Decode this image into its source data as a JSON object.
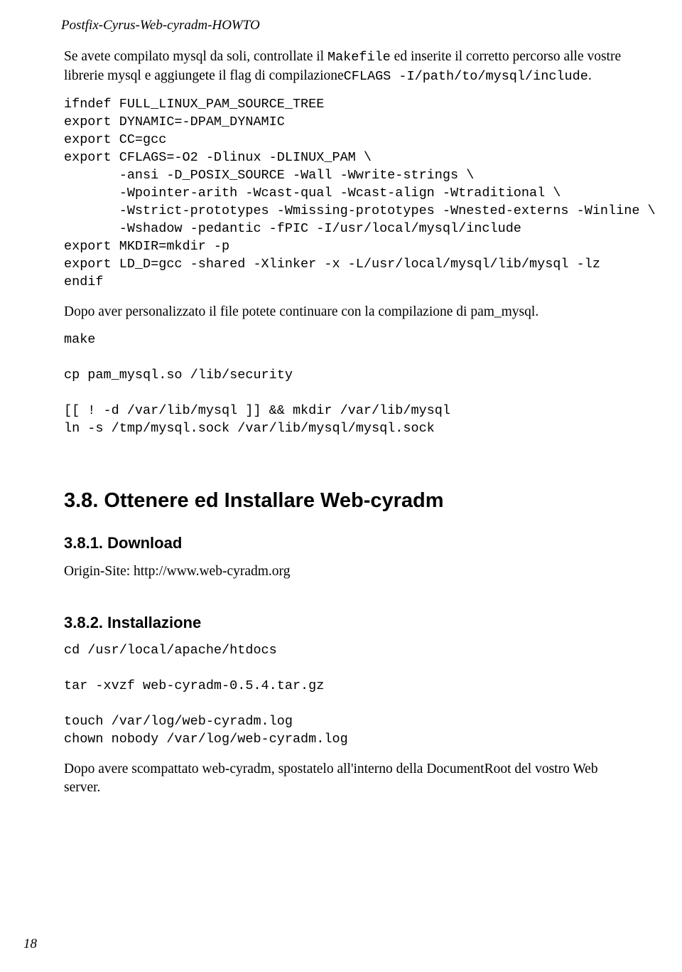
{
  "header": "Postfix-Cyrus-Web-cyradm-HOWTO",
  "intro": {
    "p1a": "Se avete compilato mysql da soli, controllate il ",
    "p1b": "Makefile",
    "p1c": " ed inserite il corretto percorso alle vostre librerie mysql e aggiungete il flag di compilazione",
    "p1d": "CFLAGS -I/path/to/mysql/include",
    "p1e": "."
  },
  "code1": "ifndef FULL_LINUX_PAM_SOURCE_TREE\nexport DYNAMIC=-DPAM_DYNAMIC\nexport CC=gcc\nexport CFLAGS=-O2 -Dlinux -DLINUX_PAM \\\n       -ansi -D_POSIX_SOURCE -Wall -Wwrite-strings \\\n       -Wpointer-arith -Wcast-qual -Wcast-align -Wtraditional \\\n       -Wstrict-prototypes -Wmissing-prototypes -Wnested-externs -Winline \\\n       -Wshadow -pedantic -fPIC -I/usr/local/mysql/include\nexport MKDIR=mkdir -p\nexport LD_D=gcc -shared -Xlinker -x -L/usr/local/mysql/lib/mysql -lz\nendif",
  "para2": "Dopo aver personalizzato il file potete continuare con la compilazione di pam_mysql.",
  "code2": "make\n\ncp pam_mysql.so /lib/security\n\n[[ ! -d /var/lib/mysql ]] && mkdir /var/lib/mysql\nln -s /tmp/mysql.sock /var/lib/mysql/mysql.sock",
  "h2": "3.8. Ottenere ed Installare Web-cyradm",
  "h3a": "3.8.1. Download",
  "origin": "Origin-Site: http://www.web-cyradm.org",
  "h3b": "3.8.2. Installazione",
  "code3": "cd /usr/local/apache/htdocs\n\ntar -xvzf web-cyradm-0.5.4.tar.gz\n\ntouch /var/log/web-cyradm.log\nchown nobody /var/log/web-cyradm.log",
  "para3": "Dopo avere scompattato web-cyradm, spostatelo all'interno della DocumentRoot del vostro Web server.",
  "pagenum": "18"
}
